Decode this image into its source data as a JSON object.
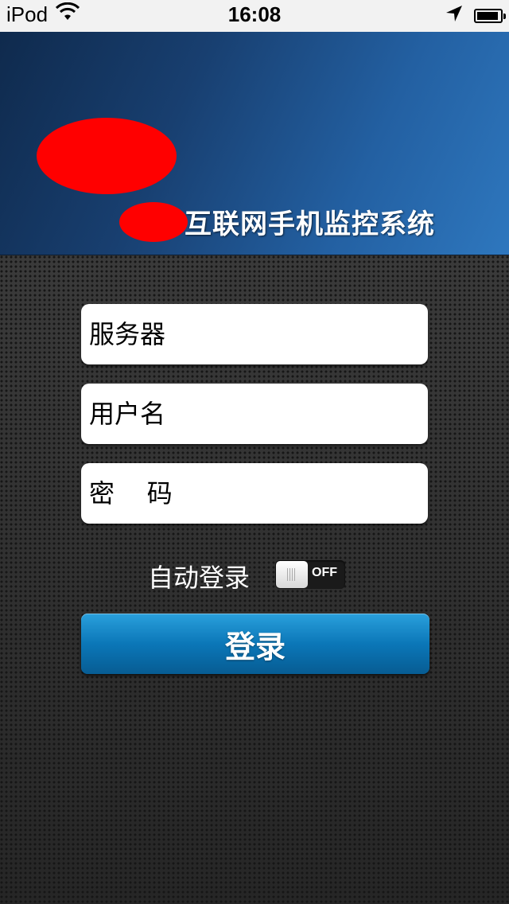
{
  "status_bar": {
    "device": "iPod",
    "time": "16:08",
    "icons": [
      "wifi-icon",
      "location-arrow-icon",
      "battery-charging-icon"
    ]
  },
  "header": {
    "title": "互联网手机监控系统"
  },
  "form": {
    "server_placeholder": "服务器",
    "username_placeholder": "用户名",
    "password_placeholder": "密    码",
    "auto_login_label": "自动登录",
    "auto_login_toggle_state": "OFF",
    "login_button_label": "登录"
  },
  "colors": {
    "banner_blue": "#2360a2",
    "button_blue": "#0b77b8",
    "redaction_red": "#ff0000",
    "background_dark": "#2b2b2b"
  }
}
